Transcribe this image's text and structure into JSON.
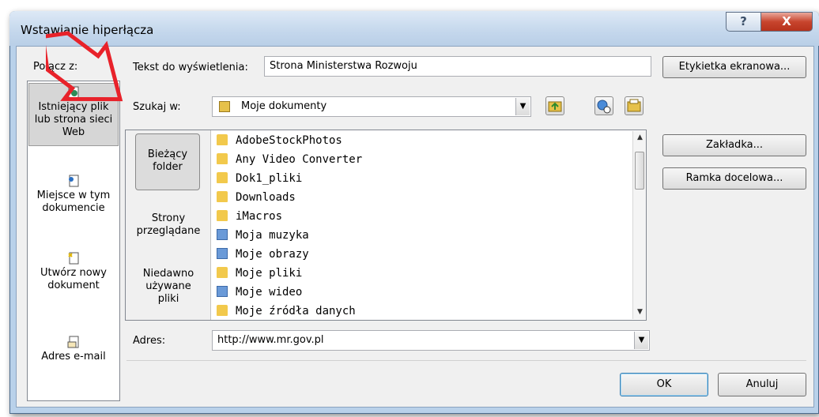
{
  "dialog": {
    "title": "Wstawianie hiperłącza",
    "help_glyph": "?",
    "close_glyph": "X"
  },
  "link_to": {
    "label": "Połącz z:",
    "items": [
      {
        "label_lines": [
          "Istniejący plik",
          "lub strona sieci",
          "Web"
        ],
        "icon": "globe-page-icon",
        "selected": true
      },
      {
        "label_lines": [
          "Miejsce w tym",
          "dokumencie"
        ],
        "icon": "document-place-icon",
        "selected": false
      },
      {
        "label_lines": [
          "Utwórz nowy",
          "dokument"
        ],
        "icon": "new-document-icon",
        "selected": false
      },
      {
        "label_lines": [
          "Adres e-mail"
        ],
        "icon": "email-icon",
        "selected": false
      }
    ]
  },
  "display_text": {
    "label": "Tekst do wyświetlenia:",
    "value": "Strona Ministerstwa Rozwoju"
  },
  "screentip_button": "Etykietka ekranowa...",
  "look_in": {
    "label": "Szukaj w:",
    "value": "Moje dokumenty"
  },
  "browse_nav": {
    "current_folder": [
      "Bieżący",
      "folder"
    ],
    "browsed_pages": [
      "Strony",
      "przeglądane"
    ],
    "recent_files": [
      "Niedawno",
      "używane",
      "pliki"
    ]
  },
  "files": [
    {
      "name": "AdobeStockPhotos",
      "icon": "folder-icon"
    },
    {
      "name": "Any Video Converter",
      "icon": "folder-icon"
    },
    {
      "name": "Dok1_pliki",
      "icon": "folder-icon"
    },
    {
      "name": "Downloads",
      "icon": "folder-icon"
    },
    {
      "name": "iMacros",
      "icon": "folder-icon"
    },
    {
      "name": "Moja muzyka",
      "icon": "music-folder-icon"
    },
    {
      "name": "Moje obrazy",
      "icon": "pictures-folder-icon"
    },
    {
      "name": "Moje pliki",
      "icon": "folder-icon"
    },
    {
      "name": "Moje wideo",
      "icon": "video-folder-icon"
    },
    {
      "name": "Moje źródła danych",
      "icon": "folder-icon"
    }
  ],
  "right_buttons": {
    "bookmark": "Zakładka...",
    "target_frame": "Ramka docelowa..."
  },
  "address": {
    "label": "Adres:",
    "value": "http://www.mr.gov.pl"
  },
  "footer": {
    "ok": "OK",
    "cancel": "Anuluj"
  },
  "colors": {
    "annotation_arrow": "#e8222a",
    "folder": "#f2c94c",
    "selected_link_bg": "#d6d6d6"
  }
}
